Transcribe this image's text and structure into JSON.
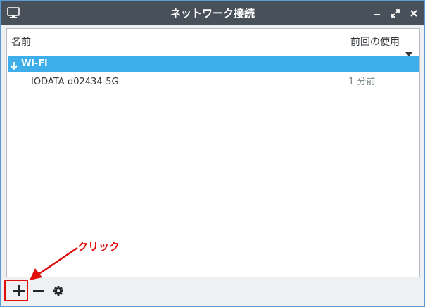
{
  "window": {
    "title": "ネットワーク接続",
    "icon": "monitor-icon",
    "controls": [
      "minimize-icon",
      "maximize-icon",
      "close-icon"
    ]
  },
  "list": {
    "columns": {
      "name": "名前",
      "last_used": "前回の使用"
    },
    "groups": [
      {
        "label": "Wi-Fi",
        "connections": [
          {
            "name": "IODATA-d02434-5G",
            "last_used": "1 分前"
          }
        ]
      }
    ]
  },
  "toolbar": {
    "add_icon": "plus-icon",
    "remove_icon": "minus-icon",
    "settings_icon": "gear-icon"
  },
  "annotation": {
    "text": "クリック",
    "color": "#e10c0c"
  },
  "colors": {
    "titlebar": "#485059",
    "selection": "#3daee9",
    "background": "#eff0f1"
  }
}
